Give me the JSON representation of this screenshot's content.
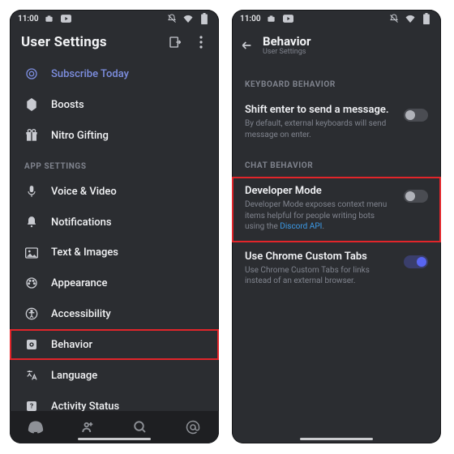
{
  "status": {
    "time": "11:00",
    "icons_left": [
      "camera",
      "youtube"
    ],
    "icons_right": [
      "silent",
      "wifi",
      "battery"
    ]
  },
  "left": {
    "title": "User Settings",
    "items": [
      {
        "icon": "target",
        "label": "Subscribe Today",
        "accent": true
      },
      {
        "icon": "boost",
        "label": "Boosts"
      },
      {
        "icon": "gift",
        "label": "Nitro Gifting"
      }
    ],
    "section": "APP SETTINGS",
    "settings_items": [
      {
        "icon": "mic",
        "label": "Voice & Video"
      },
      {
        "icon": "bell",
        "label": "Notifications"
      },
      {
        "icon": "image",
        "label": "Text & Images"
      },
      {
        "icon": "eye",
        "label": "Appearance"
      },
      {
        "icon": "accessibility",
        "label": "Accessibility"
      },
      {
        "icon": "cog",
        "label": "Behavior",
        "highlight": true
      },
      {
        "icon": "lang",
        "label": "Language"
      },
      {
        "icon": "activity",
        "label": "Activity Status"
      }
    ],
    "bottom_nav": [
      "discord",
      "friends",
      "search",
      "mentions"
    ]
  },
  "right": {
    "title": "Behavior",
    "subtitle": "User Settings",
    "cat1": "KEYBOARD BEHAVIOR",
    "s1_title": "Shift enter to send a message.",
    "s1_desc": "By default, external keyboards will send message on enter.",
    "cat2": "CHAT BEHAVIOR",
    "s2_title": "Developer Mode",
    "s2_desc_a": "Developer Mode exposes context menu items helpful for people writing bots using the ",
    "s2_link": "Discord API",
    "s2_desc_b": ".",
    "s3_title": "Use Chrome Custom Tabs",
    "s3_desc": "Use Chrome Custom Tabs for links instead of an external browser."
  }
}
